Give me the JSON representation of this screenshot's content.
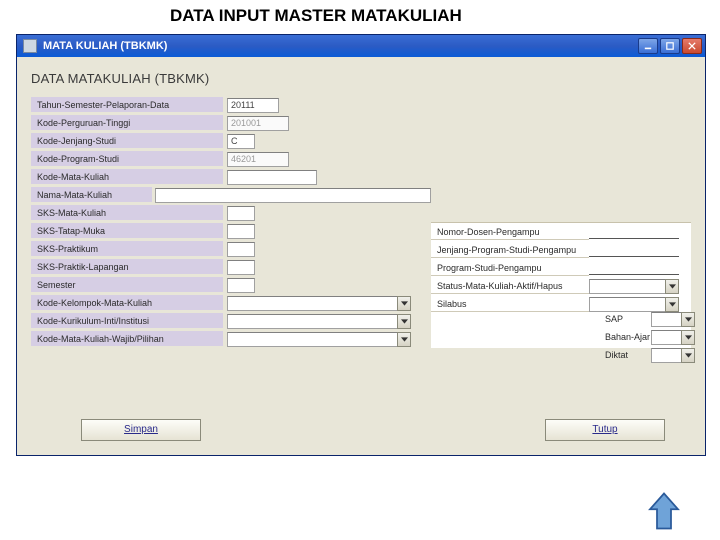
{
  "pageTitle": "DATA INPUT MASTER MATAKULIAH",
  "window": {
    "title": "MATA KULIAH (TBKMK)"
  },
  "formTitle": "DATA MATAKULIAH (TBKMK)",
  "labels": {
    "tahunSemester": "Tahun-Semester-Pelaporan-Data",
    "kodePT": "Kode-Perguruan-Tinggi",
    "kodeJenjang": "Kode-Jenjang-Studi",
    "kodeProdi": "Kode-Program-Studi",
    "kodeMK": "Kode-Mata-Kuliah",
    "namaMK": "Nama-Mata-Kuliah",
    "sksMK": "SKS-Mata-Kuliah",
    "sksTM": "SKS-Tatap-Muka",
    "sksPrak": "SKS-Praktikum",
    "sksPL": "SKS-Praktik-Lapangan",
    "semester": "Semester",
    "kodeKelompok": "Kode-Kelompok-Mata-Kuliah",
    "kodeKurikulum": "Kode-Kurikulum-Inti/Institusi",
    "kodeWajib": "Kode-Mata-Kuliah-Wajib/Pilihan",
    "nomorDosen": "Nomor-Dosen-Pengampu",
    "jenjangProdiPengampu": "Jenjang-Program-Studi-Pengampu",
    "prodiPengampu": "Program-Studi-Pengampu",
    "statusMK": "Status-Mata-Kuliah-Aktif/Hapus",
    "silabus": "Silabus",
    "sap": "SAP",
    "bahanAjar": "Bahan-Ajar",
    "diktat": "Diktat"
  },
  "values": {
    "tahunSemester": "20111",
    "kodePT": "201001",
    "kodeJenjang": "C",
    "kodeProdi": "46201",
    "kodeMK": "",
    "namaMK": "",
    "sksMK": "",
    "sksTM": "",
    "sksPrak": "",
    "sksPL": "",
    "semester": "",
    "kodeKelompok": "",
    "kodeKurikulum": "",
    "kodeWajib": "",
    "nomorDosen": "",
    "jenjangProdiPengampu": "",
    "prodiPengampu": "",
    "statusMK": "",
    "silabus": "",
    "sap": "",
    "bahanAjar": "",
    "diktat": ""
  },
  "buttons": {
    "simpan": "Simpan",
    "tutup": "Tutup"
  }
}
